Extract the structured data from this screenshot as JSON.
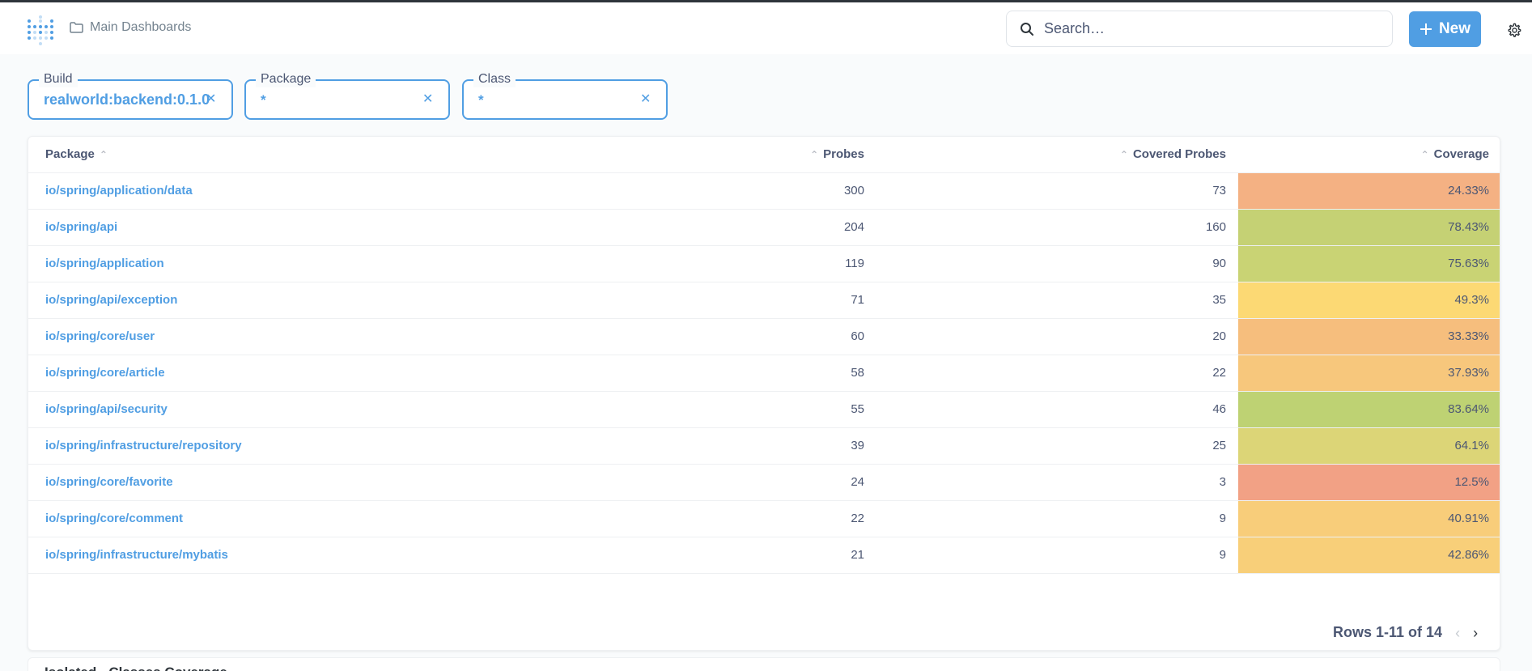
{
  "header": {
    "breadcrumb": "Main Dashboards",
    "search_placeholder": "Search…",
    "new_label": "New"
  },
  "filters": [
    {
      "label": "Build",
      "value": "realworld:backend:0.1.0"
    },
    {
      "label": "Package",
      "value": "*"
    },
    {
      "label": "Class",
      "value": "*"
    }
  ],
  "table": {
    "columns": [
      "Package",
      "Probes",
      "Covered Probes",
      "Coverage"
    ],
    "rows": [
      {
        "package": "io/spring/application/data",
        "probes": "300",
        "covered": "73",
        "coverage": "24.33%",
        "color": "#f4b183"
      },
      {
        "package": "io/spring/api",
        "probes": "204",
        "covered": "160",
        "coverage": "78.43%",
        "color": "#c5d174"
      },
      {
        "package": "io/spring/application",
        "probes": "119",
        "covered": "90",
        "coverage": "75.63%",
        "color": "#c9d374"
      },
      {
        "package": "io/spring/api/exception",
        "probes": "71",
        "covered": "35",
        "coverage": "49.3%",
        "color": "#fcd974"
      },
      {
        "package": "io/spring/core/user",
        "probes": "60",
        "covered": "20",
        "coverage": "33.33%",
        "color": "#f6be7d"
      },
      {
        "package": "io/spring/core/article",
        "probes": "58",
        "covered": "22",
        "coverage": "37.93%",
        "color": "#f7c77c"
      },
      {
        "package": "io/spring/api/security",
        "probes": "55",
        "covered": "46",
        "coverage": "83.64%",
        "color": "#bed273"
      },
      {
        "package": "io/spring/infrastructure/repository",
        "probes": "39",
        "covered": "25",
        "coverage": "64.1%",
        "color": "#dcd577"
      },
      {
        "package": "io/spring/core/favorite",
        "probes": "24",
        "covered": "3",
        "coverage": "12.5%",
        "color": "#f2a185"
      },
      {
        "package": "io/spring/core/comment",
        "probes": "22",
        "covered": "9",
        "coverage": "40.91%",
        "color": "#f8cd7a"
      },
      {
        "package": "io/spring/infrastructure/mybatis",
        "probes": "21",
        "covered": "9",
        "coverage": "42.86%",
        "color": "#f8cf79"
      }
    ]
  },
  "pagination": {
    "label": "Rows 1-11 of 14"
  },
  "next_card": {
    "title": "Isolated - Classes Coverage"
  }
}
